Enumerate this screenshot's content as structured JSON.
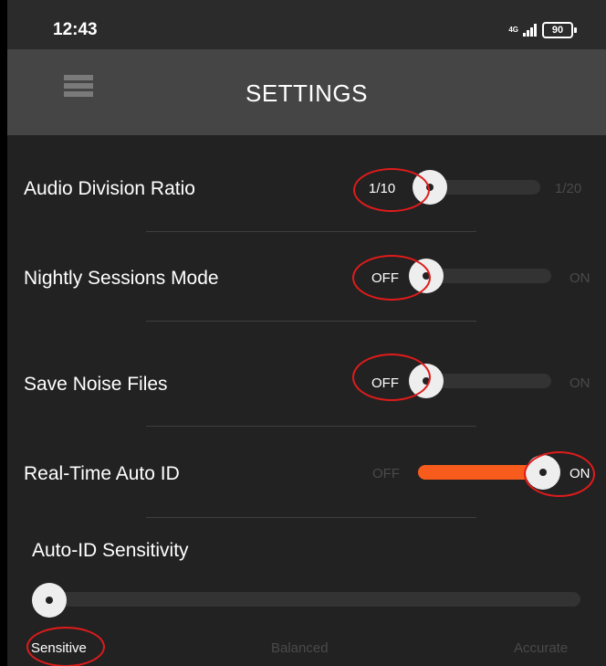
{
  "status_bar": {
    "time": "12:43",
    "network": "4G",
    "battery": "90"
  },
  "header": {
    "title": "SETTINGS"
  },
  "settings": {
    "audio_division_ratio": {
      "label": "Audio Division Ratio",
      "current": "1/10",
      "other": "1/20",
      "value": "1/10"
    },
    "nightly_sessions_mode": {
      "label": "Nightly Sessions Mode",
      "off": "OFF",
      "on": "ON",
      "value": "OFF"
    },
    "save_noise_files": {
      "label": "Save Noise Files",
      "off": "OFF",
      "on": "ON",
      "value": "OFF"
    },
    "real_time_auto_id": {
      "label": "Real-Time Auto ID",
      "off": "OFF",
      "on": "ON",
      "value": "ON"
    },
    "auto_id_sensitivity": {
      "label": "Auto-ID Sensitivity",
      "options": [
        "Sensitive",
        "Balanced",
        "Accurate"
      ],
      "value": "Sensitive"
    }
  },
  "colors": {
    "accent": "#f85c1c",
    "annotation": "#e01b1b",
    "background": "#222222",
    "appbar": "#454545"
  }
}
